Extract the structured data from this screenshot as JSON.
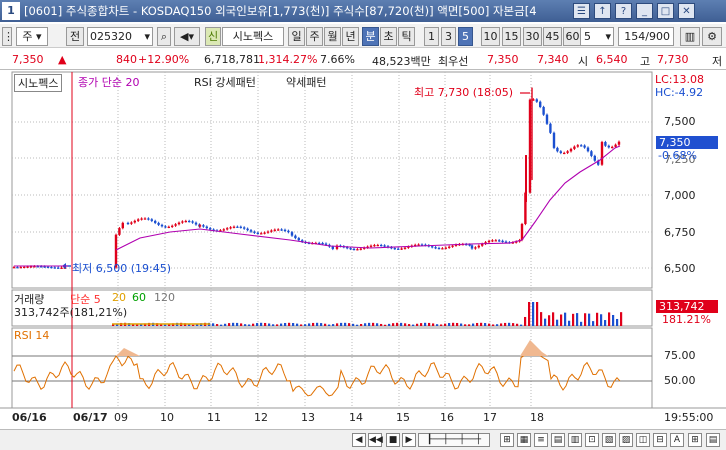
{
  "window": {
    "number": "1",
    "title": "[0601] 주식종합차트 - KOSDAQ150 외국인보유[1,773(천)] 주식수[87,720(천)] 액면[500] 자본금[4"
  },
  "toolbar": {
    "market": "주",
    "stock_code": "025320",
    "stock_name": "시노펙스",
    "sin_tag": "신",
    "periods": [
      "일",
      "주",
      "월",
      "년"
    ],
    "minute_tab": "분",
    "tick_tabs": [
      "초",
      "틱"
    ],
    "intervals": [
      "1",
      "3",
      "5",
      "10",
      "15",
      "30",
      "45",
      "60"
    ],
    "active_interval": "5",
    "unit": "5",
    "page": "154/900",
    "prev_label": "전"
  },
  "quote": {
    "price": "7,350",
    "change": "840",
    "change_rate": "+12.90%",
    "volume": "6,718,781",
    "volume_rate": "1,314.27%",
    "turnover": "7.66%",
    "amount": "48,523백만",
    "best_label": "최우선",
    "best_sell": "7,350",
    "best_buy": "7,340",
    "low_label": "시",
    "open": "6,540",
    "high_label": "고",
    "high": "7,730",
    "low2_label": "저"
  },
  "price_panel": {
    "stock": "시노펙스",
    "ma_label": "종가 단순 20",
    "rsi_pattern_label": "RSI 강세패턴",
    "rsi_weak_label": "약세패턴",
    "lc": "LC:13.08",
    "hc": "HC:-4.92",
    "high_note": "최고 7,730 (18:05)",
    "low_note": "최저 6,500 (19:45)",
    "current_price": "7,350",
    "current_change": "-0.68%",
    "y_ticks": [
      "7,500",
      "7,250",
      "7,000",
      "6,750",
      "6,500"
    ]
  },
  "volume_panel": {
    "title": "거래량",
    "ma_labels": [
      "단순 5",
      "20",
      "60",
      "120"
    ],
    "ma_colors": [
      "#ff3030",
      "#e0a000",
      "#00a000",
      "#777777"
    ],
    "value": "313,742주(181,21%)",
    "badge": "313,742",
    "badge2": "181.21%"
  },
  "rsi_panel": {
    "title": "RSI 14",
    "y_ticks": [
      "75.00",
      "50.00"
    ]
  },
  "x_axis": {
    "labels": [
      "06/16",
      "06/17",
      "09",
      "10",
      "11",
      "12",
      "13",
      "14",
      "15",
      "16",
      "17",
      "18"
    ],
    "time": "19:55:00"
  },
  "colors": {
    "up": "#e0001a",
    "down": "#1a4fd0",
    "ma": "#b000b0",
    "rsi": "#e07000"
  }
}
